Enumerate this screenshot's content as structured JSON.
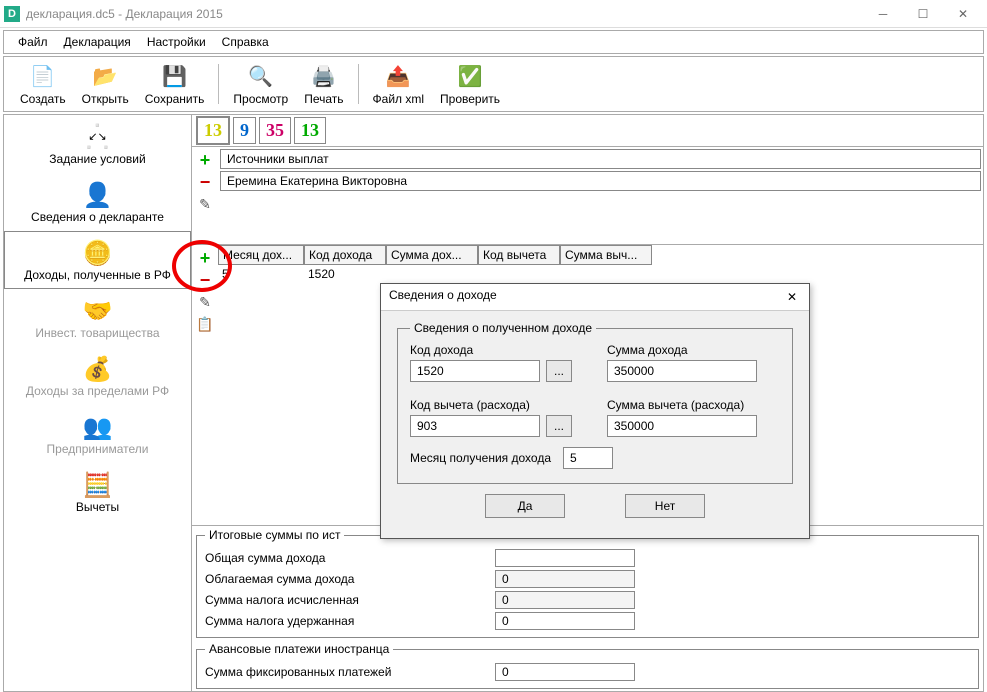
{
  "window": {
    "title": "декларация.dc5 - Декларация 2015"
  },
  "menu": {
    "file": "Файл",
    "decl": "Декларация",
    "settings": "Настройки",
    "help": "Справка"
  },
  "toolbar": {
    "create": "Создать",
    "open": "Открыть",
    "save": "Сохранить",
    "preview": "Просмотр",
    "print": "Печать",
    "filexml": "Файл xml",
    "check": "Проверить"
  },
  "sidebar": {
    "conditions": "Задание условий",
    "declarant": "Сведения о декларанте",
    "income_rf": "Доходы, полученные в РФ",
    "invest": "Инвест. товарищества",
    "income_abroad": "Доходы за пределами РФ",
    "entrepreneur": "Предприниматели",
    "deductions": "Вычеты"
  },
  "rates": {
    "r1": "13",
    "r2": "9",
    "r3": "35",
    "r4": "13"
  },
  "sources": {
    "header": "Источники выплат",
    "row1": "Еремина Екатерина Викторовна"
  },
  "income_table": {
    "cols": {
      "month": "Месяц дох...",
      "code": "Код дохода",
      "sum": "Сумма дох...",
      "ded_code": "Код вычета",
      "ded_sum": "Сумма выч..."
    },
    "row": {
      "month": "5",
      "code": "1520"
    }
  },
  "totals": {
    "group": "Итоговые суммы по ист",
    "total_income": "Общая сумма дохода",
    "taxable": "Облагаемая сумма дохода",
    "tax_calc": "Сумма налога исчисленная",
    "tax_withheld": "Сумма налога удержанная",
    "v_blank": "",
    "v_zero": "0"
  },
  "advance": {
    "group": "Авансовые платежи иностранца",
    "fixed": "Сумма фиксированных платежей",
    "v": "0"
  },
  "dialog": {
    "title": "Сведения о доходе",
    "group": "Сведения о полученном доходе",
    "code_income": "Код дохода",
    "code_income_v": "1520",
    "sum_income": "Сумма дохода",
    "sum_income_v": "350000",
    "code_ded": "Код вычета (расхода)",
    "code_ded_v": "903",
    "sum_ded": "Сумма вычета (расхода)",
    "sum_ded_v": "350000",
    "month": "Месяц получения дохода",
    "month_v": "5",
    "yes": "Да",
    "no": "Нет",
    "dots": "..."
  }
}
